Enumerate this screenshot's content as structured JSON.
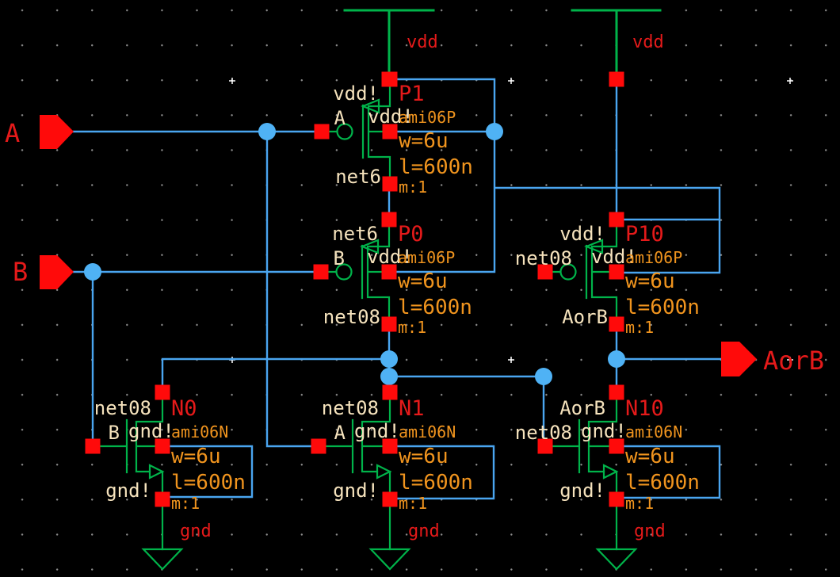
{
  "palette": {
    "background": "#000000",
    "wire_blue": "#4aa5f0",
    "junction_blue": "#4fb2f5",
    "device_green": "#00b34a",
    "pin_red": "#ff0a0a",
    "label_cream": "#f6e3bd",
    "text_red": "#e51a1a",
    "param_orange": "#f0941e",
    "grid_gray": "#8f8f8f"
  },
  "pins": {
    "input_a": "A",
    "input_b": "B",
    "output": "AorB"
  },
  "supplies": {
    "vdd_left": "vdd",
    "vdd_right": "vdd",
    "gnd_left": "gnd",
    "gnd_center": "gnd",
    "gnd_right": "gnd"
  },
  "transistors": [
    {
      "id": "P1",
      "type": "pmos",
      "name": "P1",
      "model": "ami06P",
      "w": "w=6u",
      "l": "l=600n",
      "m": "m:1",
      "drain_net": "vdd!",
      "gate_net": "A",
      "bulk_net": "vdd!",
      "source_net": "net6"
    },
    {
      "id": "P0",
      "type": "pmos",
      "name": "P0",
      "model": "ami06P",
      "w": "w=6u",
      "l": "l=600n",
      "m": "m:1",
      "drain_net": "net6",
      "gate_net": "B",
      "bulk_net": "vdd!",
      "source_net": "net08"
    },
    {
      "id": "P10",
      "type": "pmos",
      "name": "P10",
      "model": "ami06P",
      "w": "w=6u",
      "l": "l=600n",
      "m": "m:1",
      "drain_net": "vdd!",
      "gate_net": "net08",
      "bulk_net": "vdd!",
      "source_net": "AorB"
    },
    {
      "id": "N0",
      "type": "nmos",
      "name": "N0",
      "model": "ami06N",
      "w": "w=6u",
      "l": "l=600n",
      "m": "m:1",
      "drain_net": "net08",
      "gate_net": "B",
      "bulk_net": "gnd!",
      "source_net": "gnd!"
    },
    {
      "id": "N1",
      "type": "nmos",
      "name": "N1",
      "model": "ami06N",
      "w": "w=6u",
      "l": "l=600n",
      "m": "m:1",
      "drain_net": "net08",
      "gate_net": "A",
      "bulk_net": "gnd!",
      "source_net": "gnd!"
    },
    {
      "id": "N10",
      "type": "nmos",
      "name": "N10",
      "model": "ami06N",
      "w": "w=6u",
      "l": "l=600n",
      "m": "m:1",
      "drain_net": "AorB",
      "gate_net": "net08",
      "bulk_net": "gnd!",
      "source_net": "gnd!"
    }
  ]
}
